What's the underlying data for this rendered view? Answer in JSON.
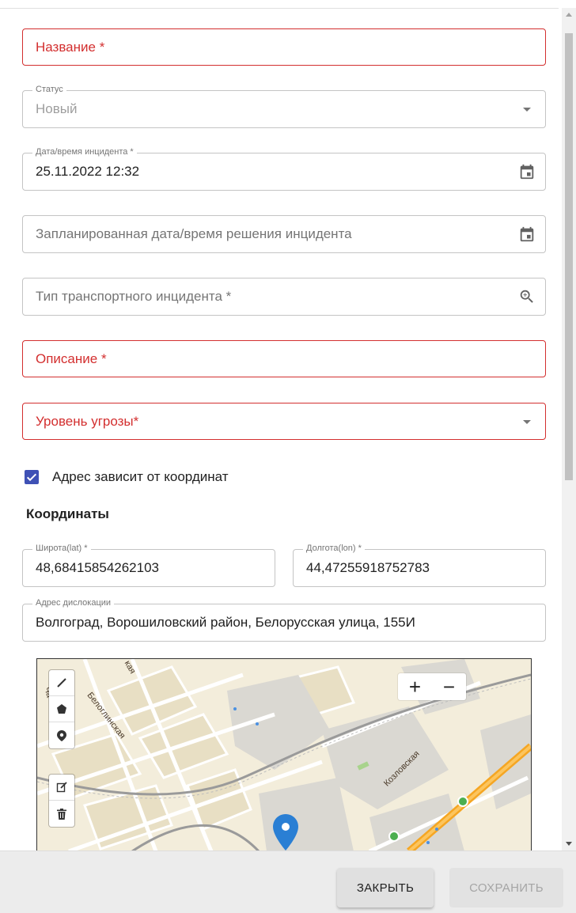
{
  "form": {
    "name": {
      "placeholder": "Название *"
    },
    "status": {
      "label": "Статус",
      "value": "Новый"
    },
    "incident_datetime": {
      "label": "Дата/время инцидента *",
      "value": "25.11.2022 12:32"
    },
    "planned_datetime": {
      "placeholder": "Запланированная дата/время решения инцидента"
    },
    "incident_type": {
      "placeholder": "Тип транспортного инцидента *"
    },
    "description": {
      "placeholder": "Описание *"
    },
    "threat_level": {
      "placeholder": "Уровень угрозы*"
    },
    "address_checkbox": {
      "label": "Адрес зависит от координат",
      "checked": true
    }
  },
  "coordinates": {
    "title": "Координаты",
    "latitude": {
      "label": "Широта(lat) *",
      "value": "48,68415854262103"
    },
    "longitude": {
      "label": "Долгота(lon) *",
      "value": "44,47255918752783"
    },
    "address": {
      "label": "Адрес дислокации",
      "value": "Волгоград, Ворошиловский район, Белорусская улица, 155И"
    }
  },
  "map": {
    "street_labels": [
      "Белоглинская",
      "Козловская",
      "Ча",
      "кая"
    ],
    "zoom_in": "+",
    "zoom_out": "−",
    "draw_tools": [
      "line-tool-icon",
      "polygon-tool-icon",
      "marker-tool-icon"
    ],
    "edit_tools": [
      "edit-icon",
      "trash-icon"
    ]
  },
  "footer": {
    "close_label": "ЗАКРЫТЬ",
    "save_label": "СОХРАНИТЬ"
  },
  "colors": {
    "error": "#d32f2f",
    "checkbox": "#3f51b5",
    "map_marker": "#2a7fd4",
    "highway": "#f5a623"
  }
}
